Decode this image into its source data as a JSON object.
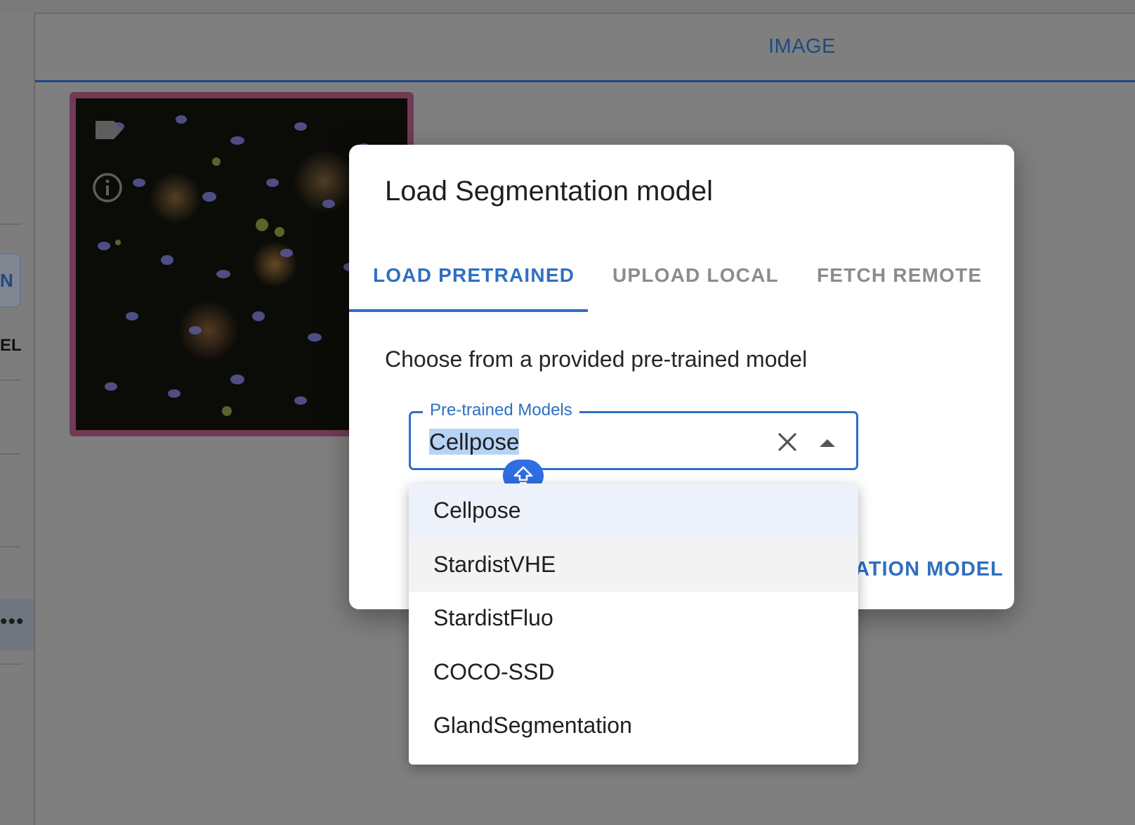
{
  "background": {
    "tab_label": "IMAGE",
    "rail_button_text": "N",
    "rail_label_text": "EL",
    "rail_more": "•••",
    "thumbnail_border_color": "#723a55"
  },
  "dialog": {
    "title": "Load Segmentation model",
    "tabs": [
      {
        "label": "LOAD PRETRAINED",
        "active": true
      },
      {
        "label": "UPLOAD LOCAL",
        "active": false
      },
      {
        "label": "FETCH REMOTE",
        "active": false
      }
    ],
    "description": "Choose from a provided pre-trained model",
    "field": {
      "label": "Pre-trained Models",
      "value": "Cellpose"
    },
    "options": [
      {
        "label": "Cellpose",
        "state": "selected"
      },
      {
        "label": "StardistVHE",
        "state": "hover"
      },
      {
        "label": "StardistFluo",
        "state": "normal"
      },
      {
        "label": "COCO-SSD",
        "state": "normal"
      },
      {
        "label": "GlandSegmentation",
        "state": "normal"
      }
    ],
    "action_partial": "ATION MODEL",
    "accent_color": "#2f6fc0"
  }
}
